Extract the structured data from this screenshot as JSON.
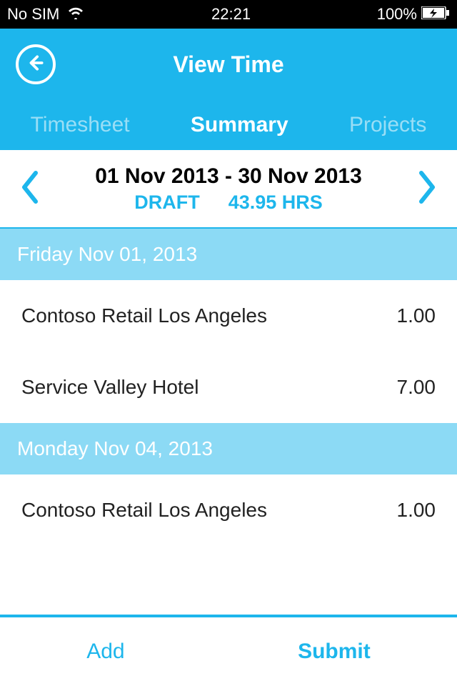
{
  "status_bar": {
    "carrier": "No SIM",
    "time": "22:21",
    "battery": "100%"
  },
  "header": {
    "title": "View Time"
  },
  "tabs": {
    "timesheet": "Timesheet",
    "summary": "Summary",
    "projects": "Projects"
  },
  "date_nav": {
    "range": "01 Nov 2013 - 30 Nov 2013",
    "status": "DRAFT",
    "hours": "43.95 HRS"
  },
  "sections": [
    {
      "label": "Friday Nov 01, 2013",
      "entries": [
        {
          "name": "Contoso Retail Los Angeles",
          "hours": "1.00"
        },
        {
          "name": "Service Valley Hotel",
          "hours": "7.00"
        }
      ]
    },
    {
      "label": "Monday Nov 04, 2013",
      "entries": [
        {
          "name": "Contoso Retail Los Angeles",
          "hours": "1.00"
        }
      ]
    }
  ],
  "bottom": {
    "add": "Add",
    "submit": "Submit"
  }
}
